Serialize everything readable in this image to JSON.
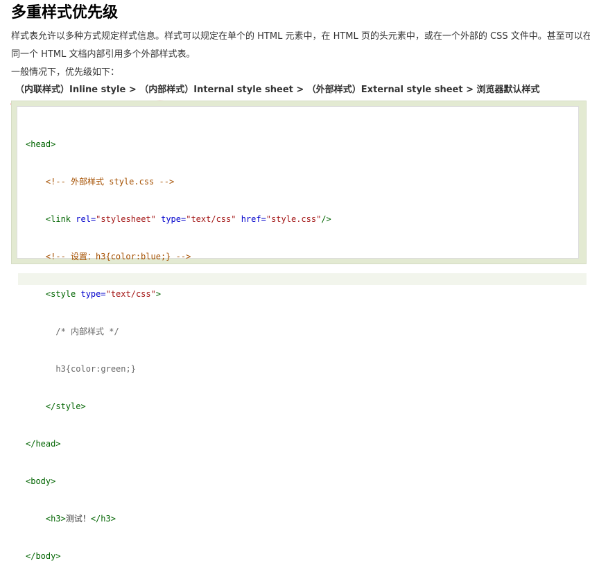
{
  "title": "多重样式优先级",
  "paragraphs": [
    "样式表允许以多种方式规定样式信息。样式可以规定在单个的 HTML 元素中，在 HTML 页的头元素中，或在一个外部的 CSS 文件中。甚至可以在",
    "同一个 HTML 文档内部引用多个外部样式表。",
    "一般情况下，优先级如下："
  ],
  "priority_line": "（内联样式）Inline style > （内部样式）Internal style sheet > （外部样式）External style sheet > 浏览器默认样式",
  "code": {
    "l1_tag": "<head>",
    "l2_comment": "<!-- 外部样式 style.css -->",
    "l3_open": "<link ",
    "l3_a1": "rel=",
    "l3_v1": "\"stylesheet\"",
    "l3_a2": " type=",
    "l3_v2": "\"text/css\"",
    "l3_a3": " href=",
    "l3_v3": "\"style.css\"",
    "l3_close": "/>",
    "l4_comment": "<!-- 设置：h3{color:blue;} -->",
    "l5_open": "<style ",
    "l5_a1": "type=",
    "l5_v1": "\"text/css\"",
    "l5_close": ">",
    "l6_css": "/* 内部样式 */",
    "l7_css": "h3{color:green;}",
    "l8_tag": "</style>",
    "l9_tag": "</head>",
    "l10_tag": "<body>",
    "l11_open": "<h3>",
    "l11_text": "测试！",
    "l11_close": "</h3>",
    "l12_tag": "</body>"
  },
  "colors": {
    "annotation_underline": "#ef4a4a",
    "code_panel_bg": "#e3ead2",
    "tag": "#006400",
    "string": "#a31515",
    "comment": "#a55000"
  }
}
